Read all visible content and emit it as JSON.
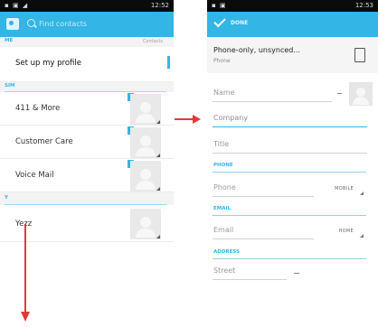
{
  "left_screen": {
    "status_time": "12:52",
    "search_placeholder": "Find contacts",
    "me_header": "ME",
    "me_count": "Contacts",
    "profile_label": "Set up my profile",
    "sim_header": "SIM",
    "contacts": [
      {
        "label": "411 & More"
      },
      {
        "label": "Customer Care"
      },
      {
        "label": "Voice Mail"
      }
    ],
    "y_header": "Y",
    "last_contact": "Yezz"
  },
  "right_screen": {
    "status_time": "12:53",
    "done_label": "DONE",
    "account_name": "Phone-only, unsynced...",
    "account_type": "Phone",
    "name_placeholder": "Name",
    "company_placeholder": "Company",
    "title_placeholder": "Title",
    "phone_header": "PHONE",
    "phone_placeholder": "Phone",
    "phone_type": "MOBILE",
    "email_header": "EMAIL",
    "email_placeholder": "Email",
    "email_type": "HOME",
    "address_header": "ADDRESS",
    "street_placeholder": "Street"
  },
  "colors": {
    "accent": "#33b5e5",
    "arrow": "#e53935"
  }
}
